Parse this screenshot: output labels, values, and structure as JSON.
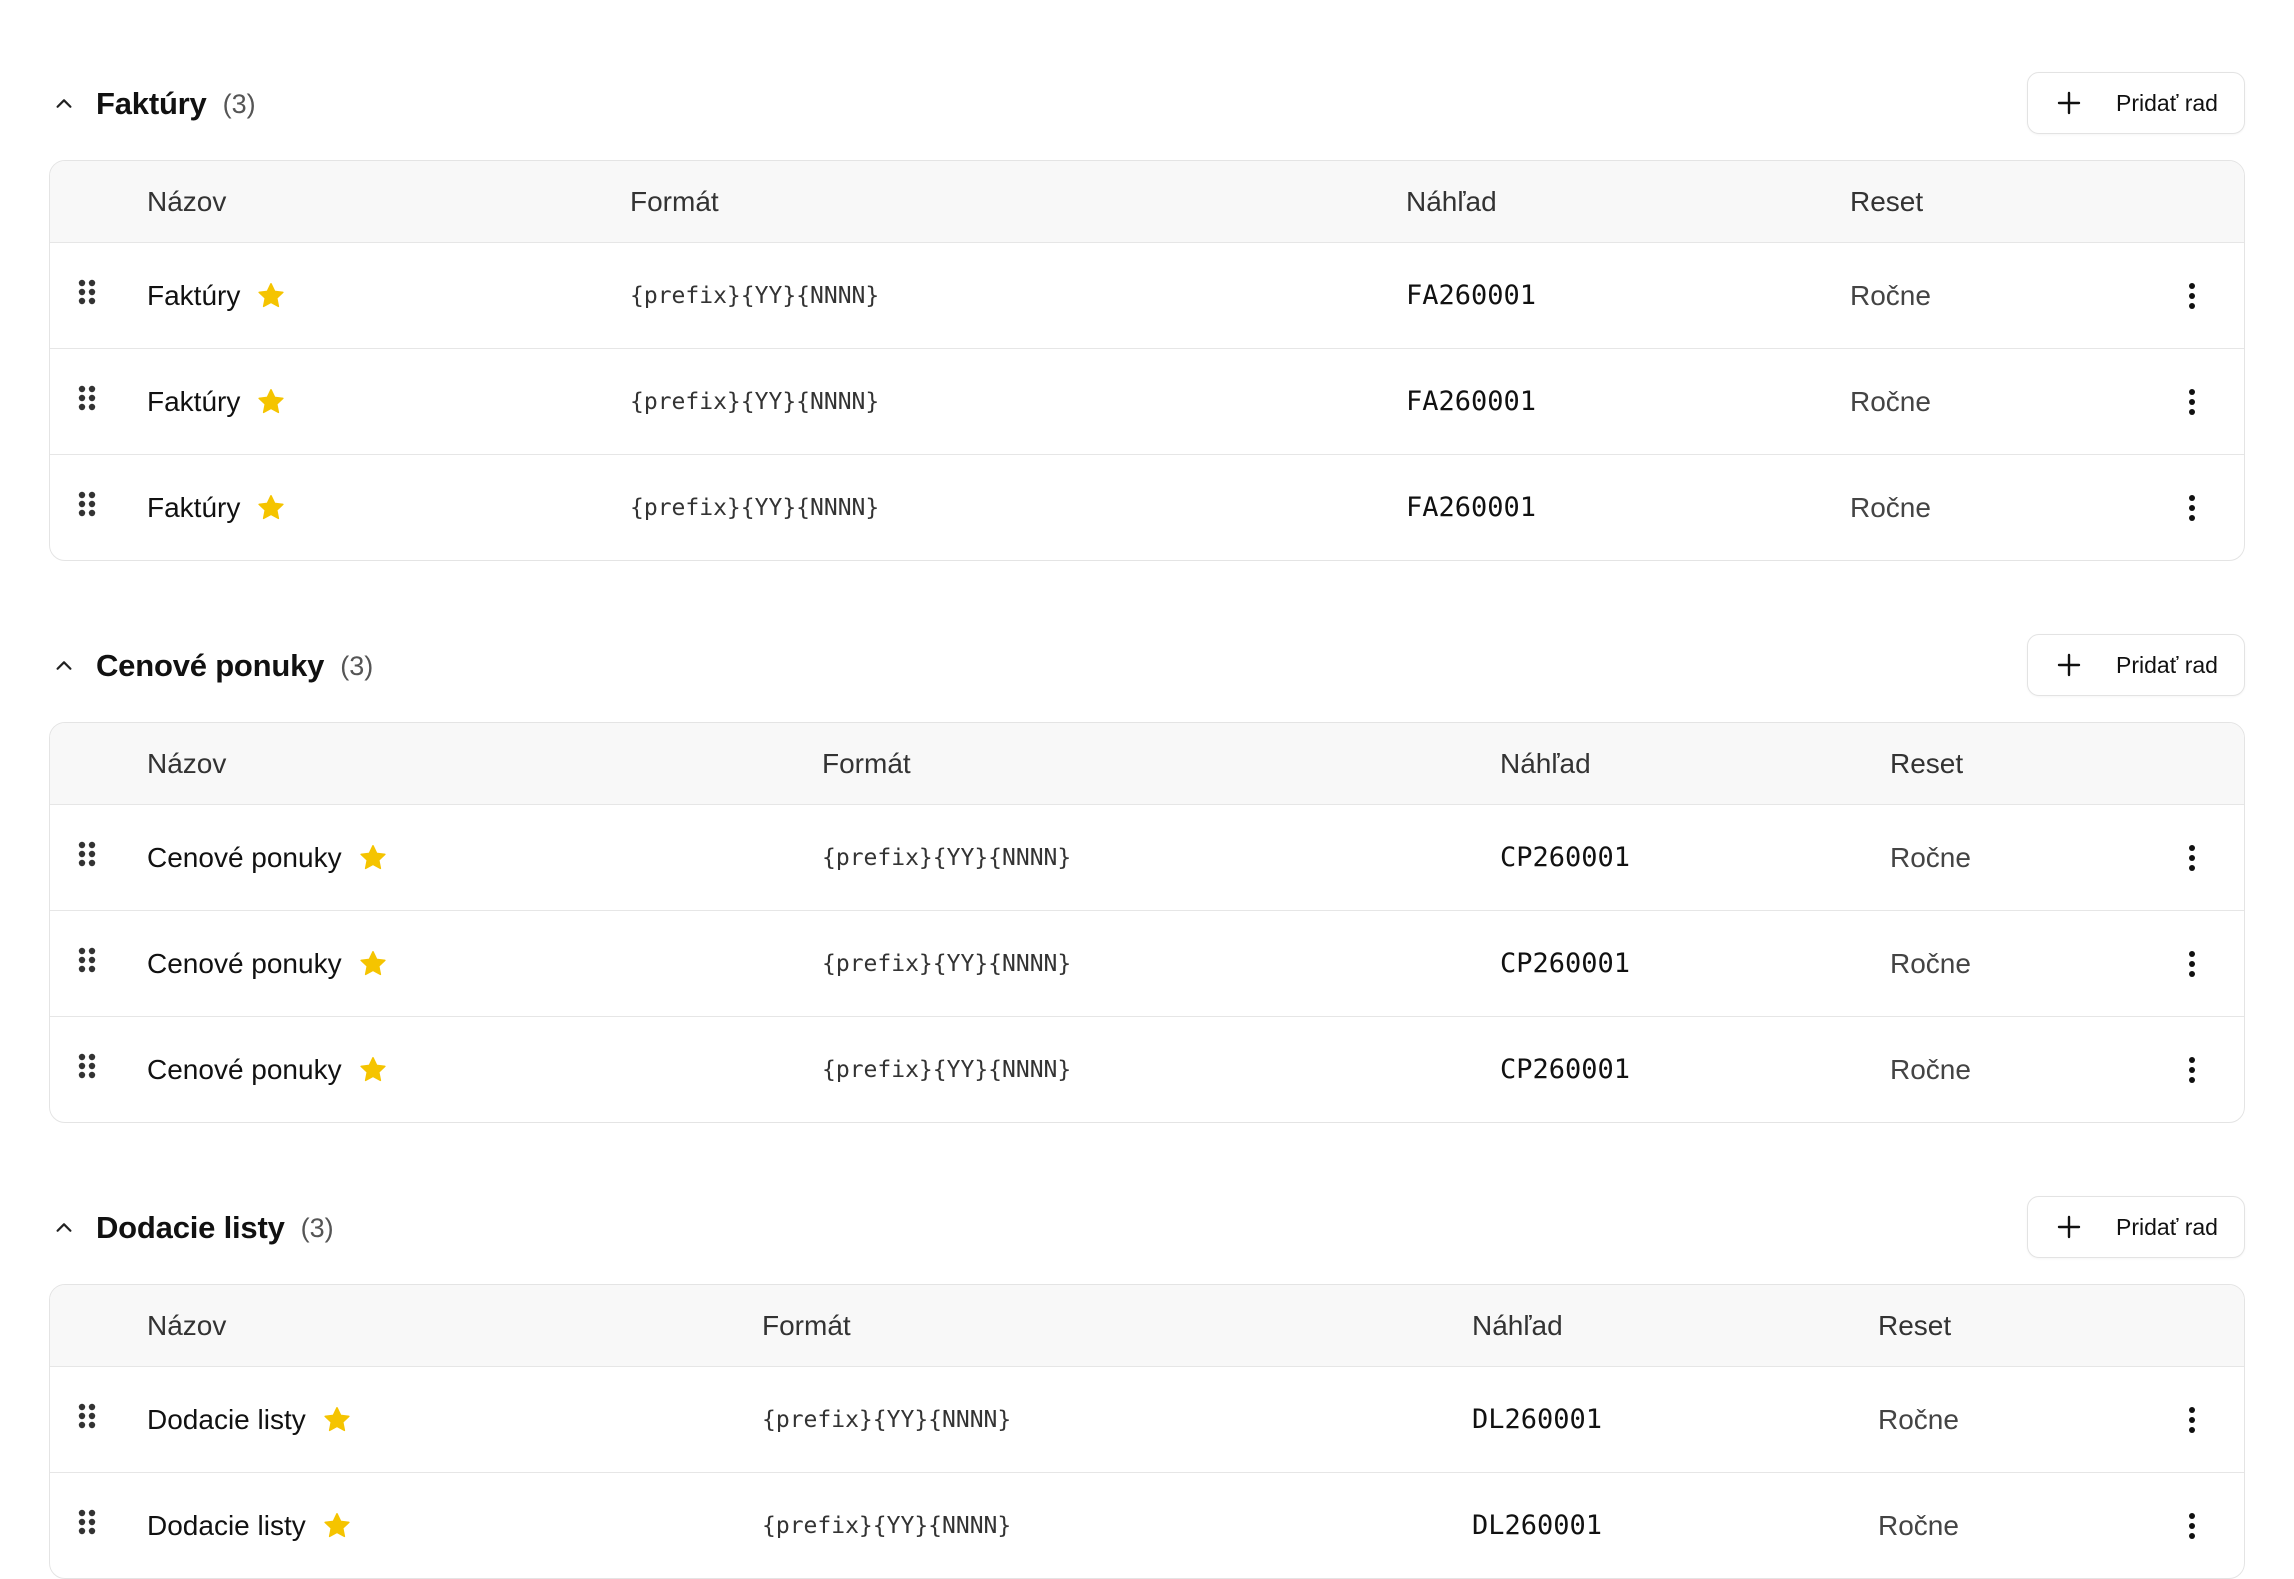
{
  "colors": {
    "star": "#F5C400",
    "border": "#E4E4E4",
    "header_bg": "#F8F8F8"
  },
  "icons": {
    "collapse": "chevron-up-icon",
    "add": "plus-icon",
    "drag": "drag-handle-icon",
    "default": "star-icon",
    "actions": "more-vertical-icon"
  },
  "sections": [
    {
      "title": "Faktúry",
      "count": "(3)",
      "add_label": "Pridať rad",
      "columns": {
        "name": "Názov",
        "format": "Formát",
        "preview": "Náhľad",
        "reset": "Reset"
      },
      "rows": [
        {
          "name": "Faktúry",
          "format": "{prefix}{YY}{NNNN}",
          "preview": "FA260001",
          "reset": "Ročne"
        },
        {
          "name": "Faktúry",
          "format": "{prefix}{YY}{NNNN}",
          "preview": "FA260001",
          "reset": "Ročne"
        },
        {
          "name": "Faktúry",
          "format": "{prefix}{YY}{NNNN}",
          "preview": "FA260001",
          "reset": "Ročne"
        }
      ]
    },
    {
      "title": "Cenové ponuky",
      "count": "(3)",
      "add_label": "Pridať rad",
      "columns": {
        "name": "Názov",
        "format": "Formát",
        "preview": "Náhľad",
        "reset": "Reset"
      },
      "rows": [
        {
          "name": "Cenové ponuky",
          "format": "{prefix}{YY}{NNNN}",
          "preview": "CP260001",
          "reset": "Ročne"
        },
        {
          "name": "Cenové ponuky",
          "format": "{prefix}{YY}{NNNN}",
          "preview": "CP260001",
          "reset": "Ročne"
        },
        {
          "name": "Cenové ponuky",
          "format": "{prefix}{YY}{NNNN}",
          "preview": "CP260001",
          "reset": "Ročne"
        }
      ]
    },
    {
      "title": "Dodacie listy",
      "count": "(3)",
      "add_label": "Pridať rad",
      "columns": {
        "name": "Názov",
        "format": "Formát",
        "preview": "Náhľad",
        "reset": "Reset"
      },
      "rows": [
        {
          "name": "Dodacie listy",
          "format": "{prefix}{YY}{NNNN}",
          "preview": "DL260001",
          "reset": "Ročne"
        },
        {
          "name": "Dodacie listy",
          "format": "{prefix}{YY}{NNNN}",
          "preview": "DL260001",
          "reset": "Ročne"
        }
      ]
    }
  ]
}
